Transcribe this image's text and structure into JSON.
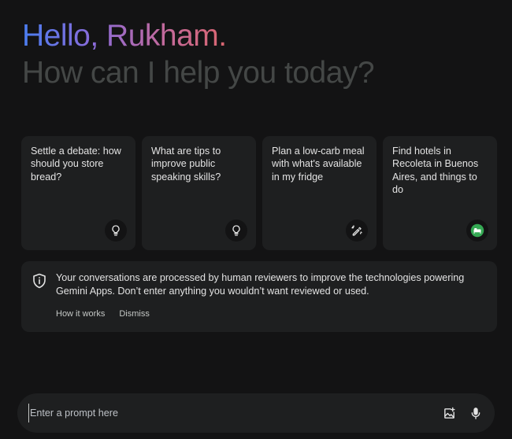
{
  "greeting": {
    "hello": "Hello, Rukham.",
    "subtitle": "How can I help you today?"
  },
  "cards": [
    {
      "text": "Settle a debate: how should you store bread?",
      "icon": "lightbulb-icon"
    },
    {
      "text": "What are tips to improve public speaking skills?",
      "icon": "lightbulb-icon"
    },
    {
      "text": "Plan a low-carb meal with what's available in my fridge",
      "icon": "pencil-sparkle-icon"
    },
    {
      "text": "Find hotels in Recoleta in Buenos Aires, and things to do",
      "icon": "google-hotels-icon"
    }
  ],
  "notice": {
    "icon": "shield-info-icon",
    "text": "Your conversations are processed by human reviewers to improve the technologies powering Gemini Apps. Don’t enter anything you wouldn’t want reviewed or used.",
    "how_it_works": "How it works",
    "dismiss": "Dismiss"
  },
  "prompt": {
    "placeholder": "Enter a prompt here",
    "value": "",
    "image_icon": "add-image-icon",
    "mic_icon": "microphone-icon"
  },
  "colors": {
    "background": "#131314",
    "surface": "#1e1f20",
    "text": "#e3e3e3",
    "subtitle": "#444746",
    "gradient_start": "#4a7df0",
    "gradient_end": "#d9656f",
    "hotels_green": "#34a853"
  }
}
